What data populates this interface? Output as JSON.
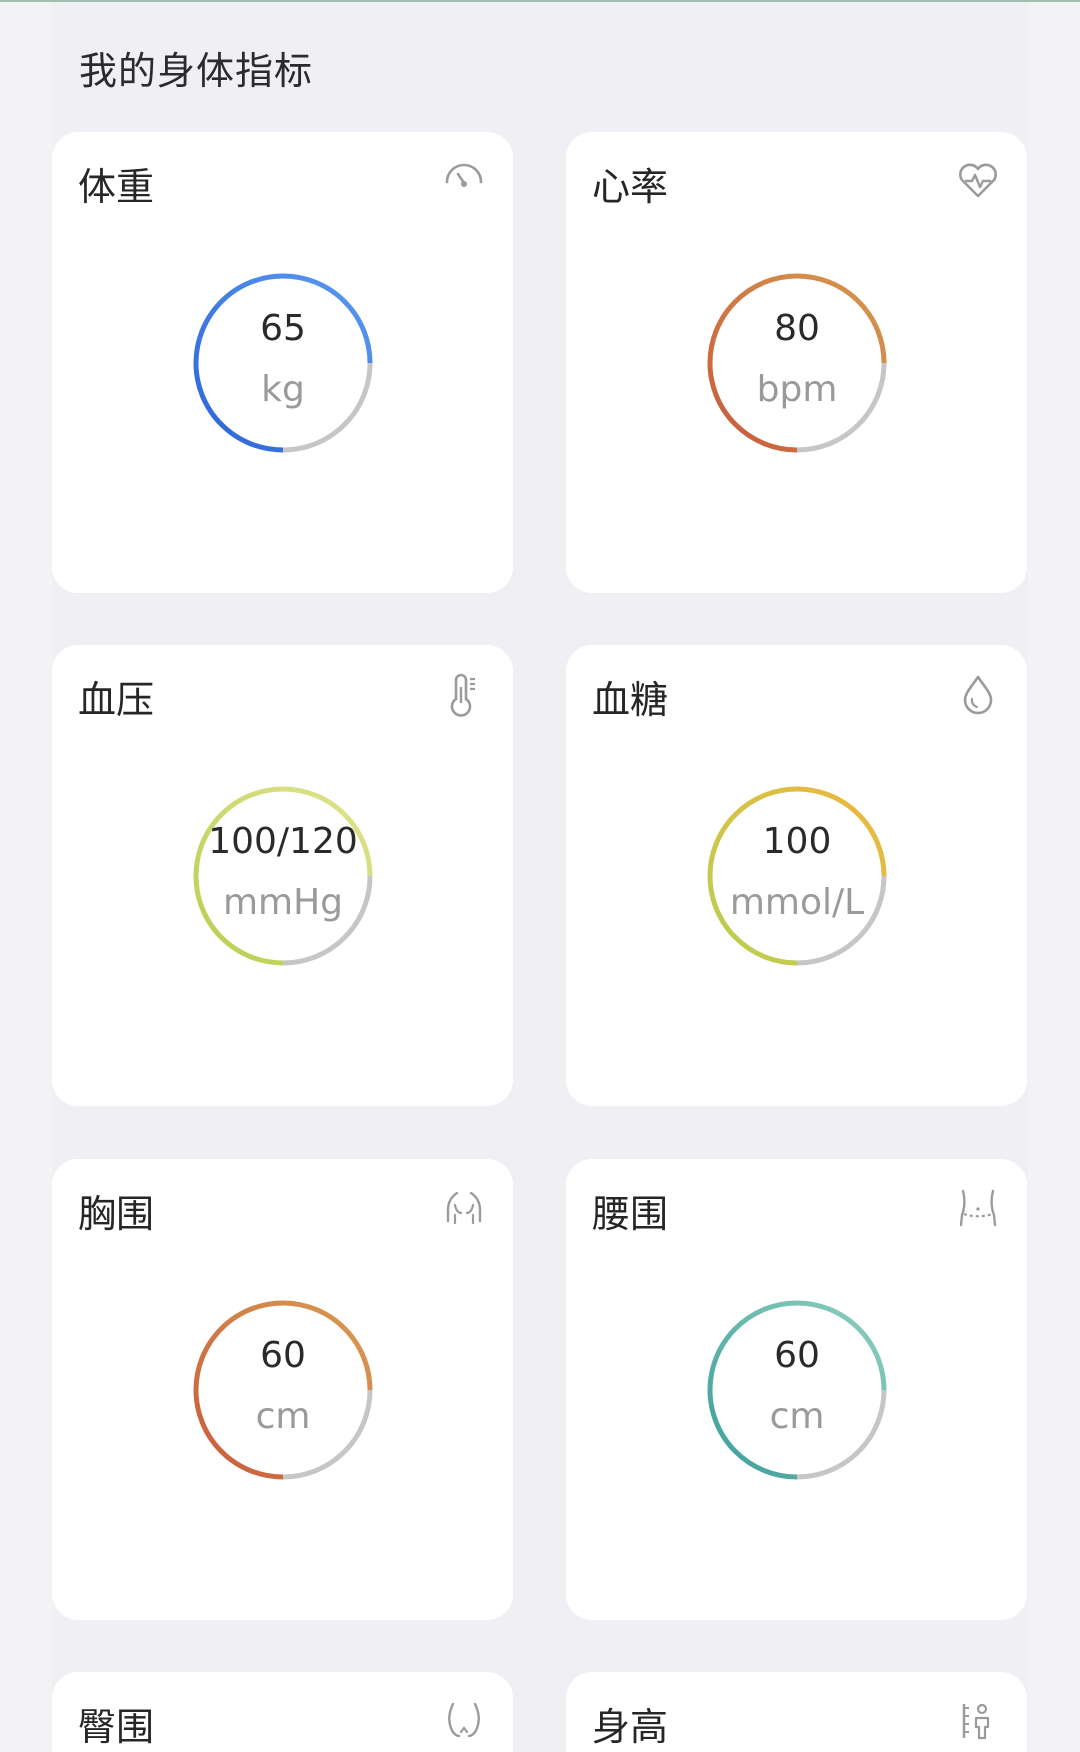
{
  "page": {
    "title": "我的身体指标"
  },
  "cards": [
    {
      "title": "体重",
      "icon": "speedometer-icon",
      "value": "65",
      "unit": "kg",
      "colors": [
        "#2c63d8",
        "#5b9bf0"
      ]
    },
    {
      "title": "心率",
      "icon": "heart-pulse-icon",
      "value": "80",
      "unit": "bpm",
      "colors": [
        "#c85a3d",
        "#d79a4e"
      ]
    },
    {
      "title": "血压",
      "icon": "thermometer-icon",
      "value": "100/120",
      "unit": "mmHg",
      "colors": [
        "#b7cf4e",
        "#e2e391"
      ]
    },
    {
      "title": "血糖",
      "icon": "water-drop-icon",
      "value": "100",
      "unit": "mmol/L",
      "colors": [
        "#b9d052",
        "#efb63c"
      ]
    },
    {
      "title": "胸围",
      "icon": "chest-icon",
      "value": "60",
      "unit": "cm",
      "colors": [
        "#c95a3c",
        "#d89d52"
      ]
    },
    {
      "title": "腰围",
      "icon": "waist-icon",
      "value": "60",
      "unit": "cm",
      "colors": [
        "#3c9e9a",
        "#8fcfc0"
      ]
    },
    {
      "title": "臀围",
      "icon": "hip-icon"
    },
    {
      "title": "身高",
      "icon": "height-icon"
    }
  ],
  "gauge_track_color": "#c6c6c6"
}
